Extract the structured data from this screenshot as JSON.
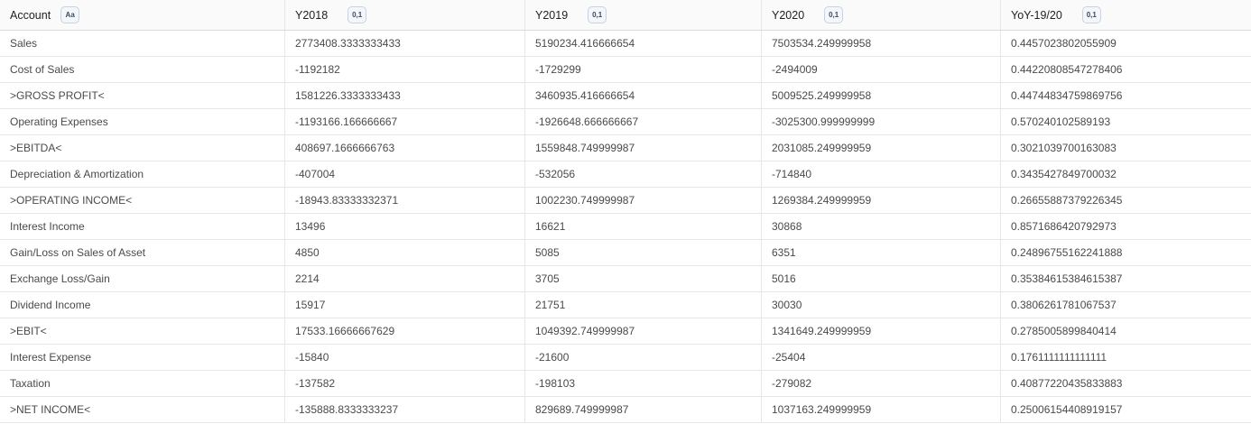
{
  "columns": [
    {
      "label": "Account",
      "type_badge": "Aa"
    },
    {
      "label": "Y2018",
      "type_badge": "0,1"
    },
    {
      "label": "Y2019",
      "type_badge": "0,1"
    },
    {
      "label": "Y2020",
      "type_badge": "0,1"
    },
    {
      "label": "YoY-19/20",
      "type_badge": "0,1"
    }
  ],
  "rows": [
    [
      "Sales",
      "2773408.3333333433",
      "5190234.416666654",
      "7503534.249999958",
      "0.4457023802055909"
    ],
    [
      "Cost of Sales",
      "-1192182",
      "-1729299",
      "-2494009",
      "0.44220808547278406"
    ],
    [
      ">GROSS PROFIT<",
      "1581226.3333333433",
      "3460935.416666654",
      "5009525.249999958",
      "0.44744834759869756"
    ],
    [
      "Operating Expenses",
      "-1193166.166666667",
      "-1926648.666666667",
      "-3025300.999999999",
      "0.570240102589193"
    ],
    [
      ">EBITDA<",
      "408697.1666666763",
      "1559848.749999987",
      "2031085.249999959",
      "0.3021039700163083"
    ],
    [
      "Depreciation & Amortization",
      "-407004",
      "-532056",
      "-714840",
      "0.3435427849700032"
    ],
    [
      ">OPERATING INCOME<",
      "-18943.83333332371",
      "1002230.749999987",
      "1269384.249999959",
      "0.26655887379226345"
    ],
    [
      "Interest Income",
      "13496",
      "16621",
      "30868",
      "0.8571686420792973"
    ],
    [
      "Gain/Loss on Sales of Asset",
      "4850",
      "5085",
      "6351",
      "0.24896755162241888"
    ],
    [
      "Exchange Loss/Gain",
      "2214",
      "3705",
      "5016",
      "0.35384615384615387"
    ],
    [
      "Dividend Income",
      "15917",
      "21751",
      "30030",
      "0.3806261781067537"
    ],
    [
      ">EBIT<",
      "17533.16666667629",
      "1049392.749999987",
      "1341649.249999959",
      "0.2785005899840414"
    ],
    [
      "Interest Expense",
      "-15840",
      "-21600",
      "-25404",
      "0.1761111111111111"
    ],
    [
      "Taxation",
      "-137582",
      "-198103",
      "-279082",
      "0.40877220435833883"
    ],
    [
      ">NET INCOME<",
      "-135888.8333333237",
      "829689.749999987",
      "1037163.249999959",
      "0.25006154408919157"
    ]
  ]
}
